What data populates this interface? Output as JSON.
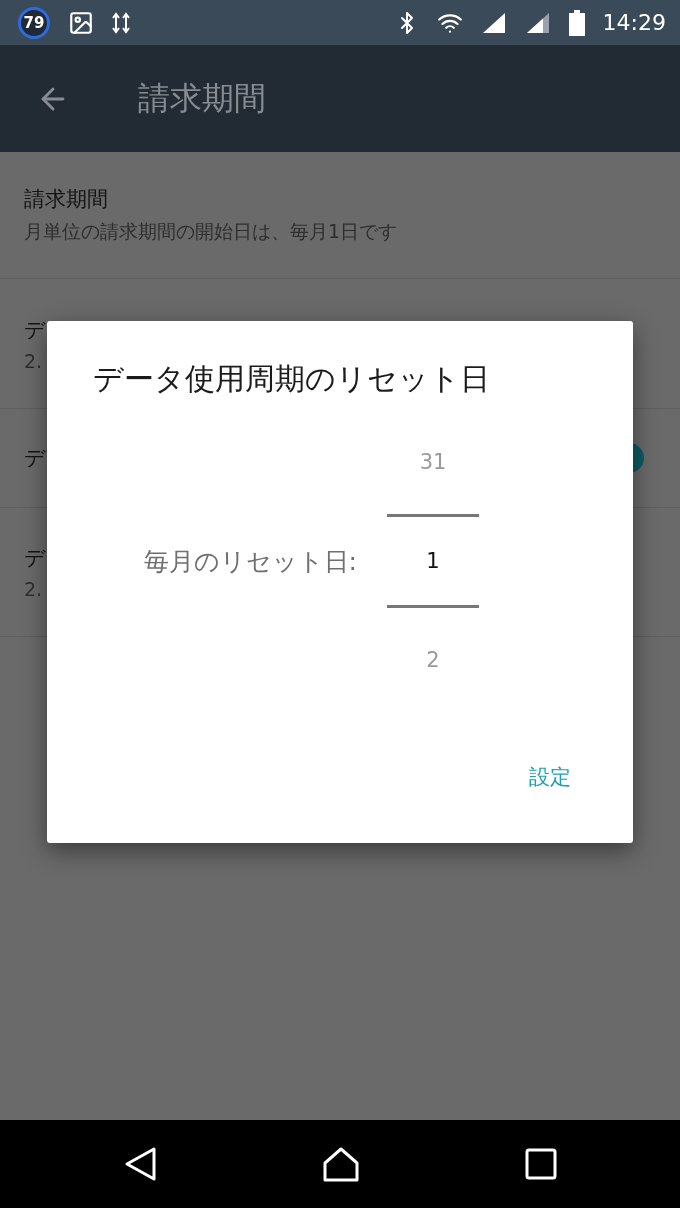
{
  "status_bar": {
    "notification_badge": "79",
    "time": "14:29"
  },
  "app_bar": {
    "title": "請求期間"
  },
  "settings": [
    {
      "kind": "text",
      "title": "請求期間",
      "summary": "月単位の請求期間の開始日は、毎月1日です"
    },
    {
      "kind": "text",
      "title": "デ",
      "summary": "2."
    },
    {
      "kind": "switch",
      "title": "デ",
      "on": true
    },
    {
      "kind": "text",
      "title": "デ",
      "summary": "2."
    }
  ],
  "dialog": {
    "title": "データ使用周期のリセット日",
    "picker_label": "毎月のリセット日:",
    "picker": [
      {
        "value": "31",
        "selected": false
      },
      {
        "value": "1",
        "selected": true
      },
      {
        "value": "2",
        "selected": false
      }
    ],
    "button": "設定"
  }
}
